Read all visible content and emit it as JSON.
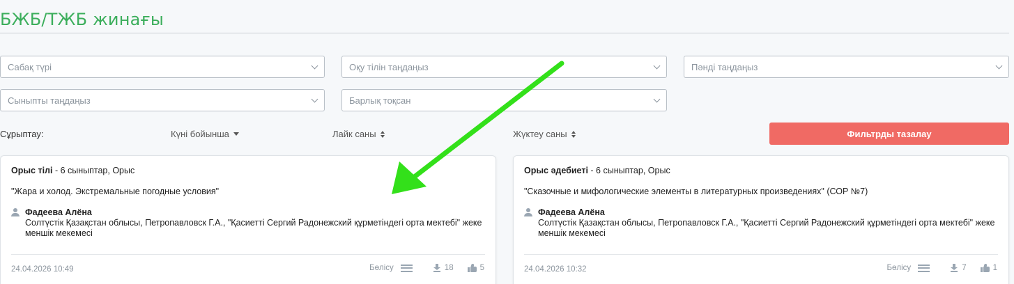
{
  "page": {
    "title": "БЖБ/ТЖБ жинағы"
  },
  "filters": {
    "lesson_type": "Сабақ түрі",
    "language": "Оқу тілін таңдаңыз",
    "subject": "Пәнді таңдаңыз",
    "grade": "Сыныпты таңдаңыз",
    "quarter": "Барлық тоқсан"
  },
  "sort": {
    "label": "Сұрыптау:",
    "by_date": "Күні бойынша",
    "by_likes": "Лайк саны",
    "by_downloads": "Жүктеу саны"
  },
  "clear_filters_label": "Фильтрды тазалау",
  "cards": [
    {
      "subject": "Орыс тілі",
      "meta": " - 6 сыныптар, Орыс",
      "topic": "\"Жара и холод. Экстремальные погодные условия\"",
      "author": "Фадеева Алёна",
      "school": "Солтүстік Қазақстан облысы, Петропавловск Г.А., \"Қасиетті Сергий Радонежский құрметіндегі орта мектебі\" жеке меншік мекемесі",
      "date": "24.04.2026 10:49",
      "share_label": "Бөлісу",
      "downloads": "18",
      "likes": "5"
    },
    {
      "subject": "Орыс әдебиеті",
      "meta": " - 6 сыныптар, Орыс",
      "topic": "\"Сказочные и мифологические элементы в литературных произведениях\" (СОР №7)",
      "author": "Фадеева Алёна",
      "school": "Солтүстік Қазақстан облысы, Петропавловск Г.А., \"Қасиетті Сергий Радонежский құрметіндегі орта мектебі\" жеке меншік мекемесі",
      "date": "24.04.2026 10:32",
      "share_label": "Бөлісу",
      "downloads": "7",
      "likes": "1"
    }
  ],
  "colors": {
    "title_green": "#3cae5c",
    "clear_button": "#f06a64",
    "annotation_arrow": "#33e01a"
  }
}
